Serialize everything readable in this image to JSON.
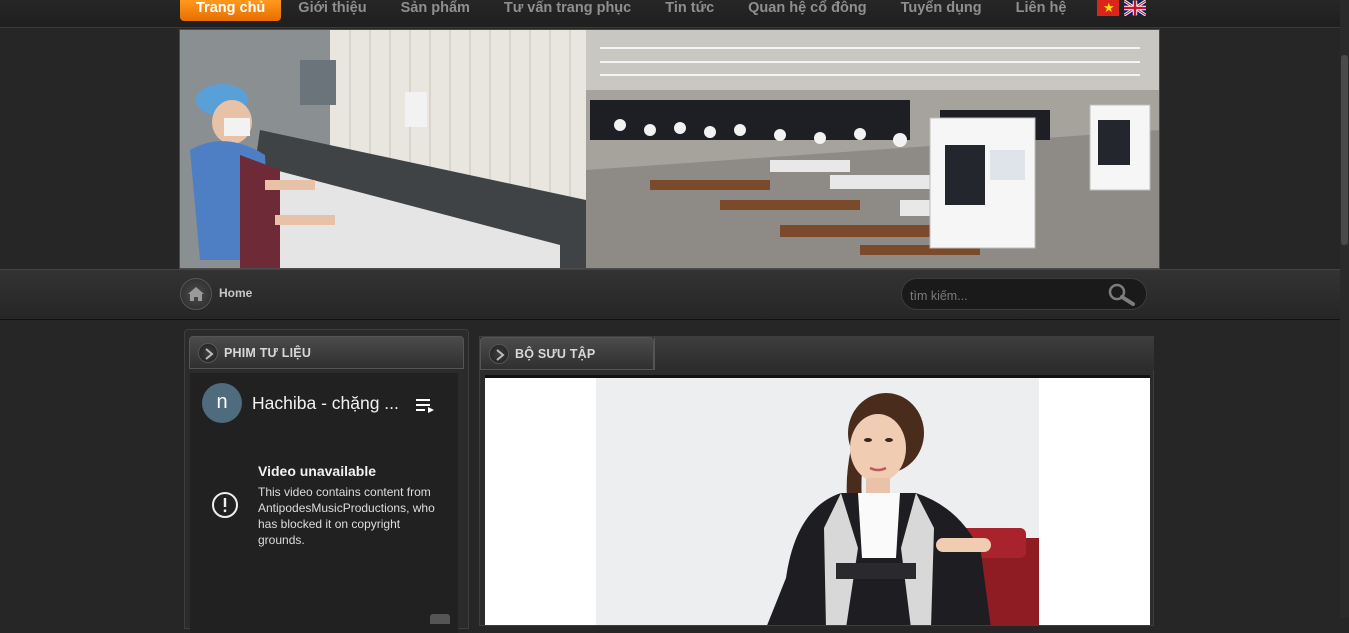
{
  "nav": {
    "items": [
      {
        "label": "Trang chủ",
        "active": true
      },
      {
        "label": "Giới thiệu",
        "active": false
      },
      {
        "label": "Sản phẩm",
        "active": false
      },
      {
        "label": "Tư vấn trang phục",
        "active": false
      },
      {
        "label": "Tin tức",
        "active": false
      },
      {
        "label": "Quan hệ cổ đông",
        "active": false
      },
      {
        "label": "Tuyển dụng",
        "active": false
      },
      {
        "label": "Liên hệ",
        "active": false
      }
    ],
    "languages": [
      "vn-flag-icon",
      "uk-flag-icon"
    ]
  },
  "breadcrumb": {
    "home_label": "Home"
  },
  "search": {
    "placeholder": "tìm kiếm..."
  },
  "left_panel": {
    "title": "PHIM TƯ LIỆU",
    "video": {
      "channel_initial": "n",
      "title": "Hachiba - chặng ...",
      "unavailable_title": "Video unavailable",
      "unavailable_message": "This video contains content from AntipodesMusicProductions, who has blocked it on copyright grounds."
    }
  },
  "right_panel": {
    "title": "BỘ SƯU TẬP"
  },
  "colors": {
    "accent": "#f07d00",
    "background": "#262626",
    "avatar": "#4f6b7e"
  }
}
